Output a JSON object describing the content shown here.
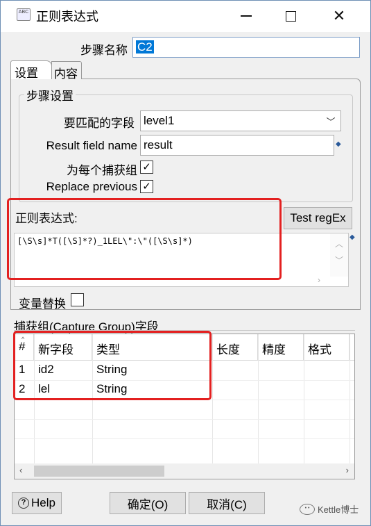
{
  "window": {
    "title": "正则表达式",
    "icon_name": "regex-dialog-icon",
    "icon_text": "ABC"
  },
  "step_name": {
    "label": "步骤名称",
    "value": "C2"
  },
  "tabs": [
    {
      "label": "设置",
      "active": true
    },
    {
      "label": "内容",
      "active": false
    }
  ],
  "settings_group": {
    "title": "步骤设置",
    "field_to_match": {
      "label": "要匹配的字段",
      "value": "level1"
    },
    "result_field": {
      "label": "Result field name",
      "value": "result"
    },
    "per_capture_group": {
      "label": "为每个捕获组",
      "checked": true
    },
    "replace_previous": {
      "label": "Replace previous",
      "checked": true
    }
  },
  "regex": {
    "label": "正则表达式:",
    "test_button": "Test regEx",
    "value": "[\\S\\s]*T([\\S]*?)_1LEL\\\":\\\"([\\S\\s]*)"
  },
  "variable_replace": {
    "label": "变量替换",
    "checked": false
  },
  "capture_groups": {
    "title": "捕获组(Capture Group)字段",
    "columns": [
      "#",
      "新字段",
      "类型",
      "长度",
      "精度",
      "格式"
    ],
    "rows": [
      {
        "num": "1",
        "field": "id2",
        "type": "String"
      },
      {
        "num": "2",
        "field": "lel",
        "type": "String"
      }
    ]
  },
  "buttons": {
    "help": "Help",
    "ok": "确定(O)",
    "cancel": "取消(C)"
  },
  "watermark": "Kettle博士",
  "colors": {
    "highlight_red": "#e32020",
    "selection_blue": "#0078d7"
  }
}
